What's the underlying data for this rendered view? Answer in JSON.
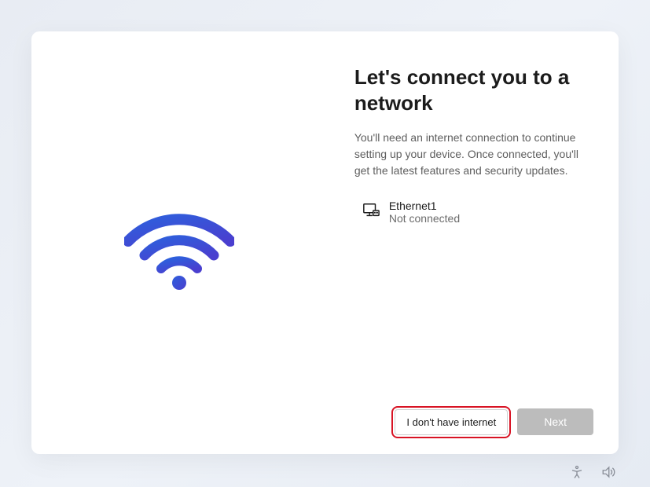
{
  "heading": "Let's connect you to a network",
  "description": "You'll need an internet connection to continue setting up your device. Once connected, you'll get the latest features and security updates.",
  "network": {
    "name": "Ethernet1",
    "status": "Not connected"
  },
  "buttons": {
    "noInternet": "I don't have internet",
    "next": "Next"
  },
  "icons": {
    "wifi": "wifi-icon",
    "ethernet": "ethernet-monitor-icon",
    "accessibility": "accessibility-icon",
    "volume": "volume-icon"
  },
  "colors": {
    "wifiGradientStart": "#2e5fdc",
    "wifiGradientEnd": "#4a3fcf",
    "highlight": "#d81324"
  }
}
